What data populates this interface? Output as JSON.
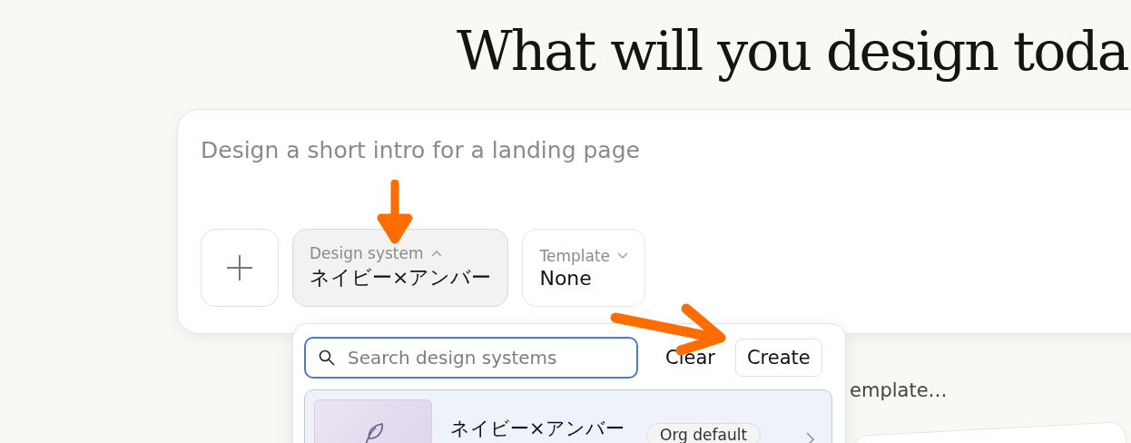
{
  "heading": "What will you design toda",
  "prompt": {
    "placeholder": "Design a short intro for a landing page"
  },
  "pickers": [
    {
      "label": "Design system",
      "value": "ネイビー×アンバー",
      "expanded": true
    },
    {
      "label": "Template",
      "value": "None",
      "expanded": false
    }
  ],
  "menu": {
    "search": {
      "placeholder": "Search design systems"
    },
    "buttons": [
      {
        "label": "Clear",
        "kind": "text"
      },
      {
        "label": "Create",
        "kind": "outlined"
      }
    ],
    "items": [
      {
        "name": "ネイビー×アンバー",
        "badge": "Org default",
        "selected": true
      }
    ]
  },
  "behind_text": "emplate…"
}
